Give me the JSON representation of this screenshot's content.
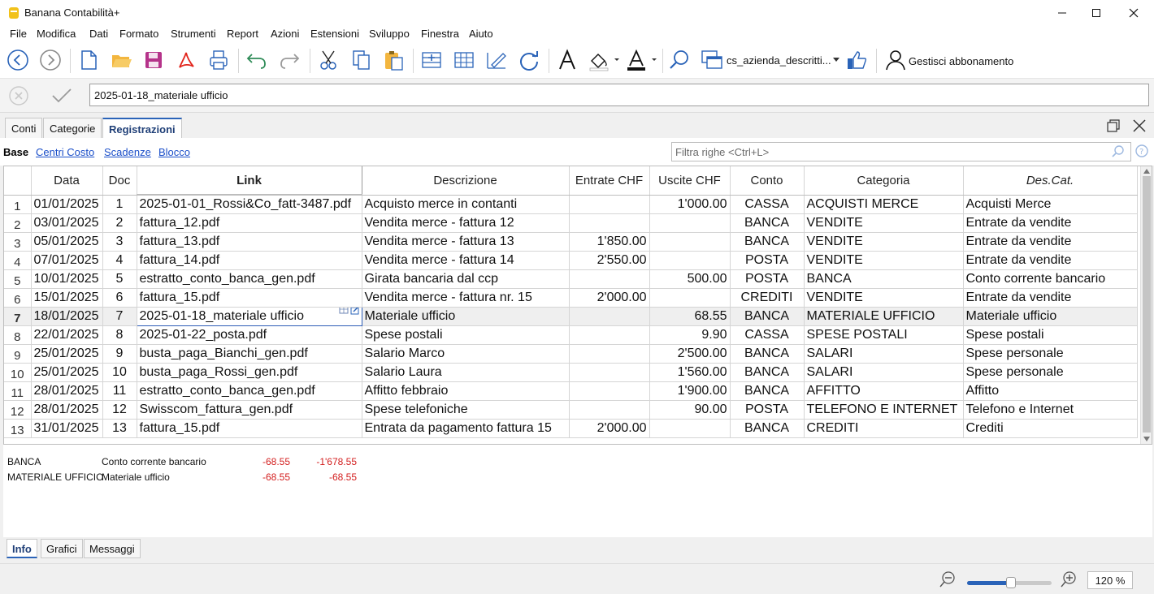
{
  "window": {
    "title": "Banana Contabilità+"
  },
  "menu": [
    "File",
    "Modifica",
    "Dati",
    "Formato",
    "Strumenti",
    "Report",
    "Azioni",
    "Estensioni",
    "Sviluppo",
    "Finestra",
    "Aiuto"
  ],
  "toolbar": {
    "file_name": "cs_azienda_descritti...",
    "subscription_label": "Gestisci abbonamento"
  },
  "edit_bar": {
    "value": "2025-01-18_materiale ufficio"
  },
  "tabs": [
    "Conti",
    "Categorie",
    "Registrazioni"
  ],
  "active_tab": "Registrazioni",
  "views": [
    "Base",
    "Centri Costo",
    "Scadenze",
    "Blocco"
  ],
  "filter": {
    "placeholder": "Filtra righe <Ctrl+L>"
  },
  "table": {
    "headers": [
      "Data",
      "Doc",
      "Link",
      "Descrizione",
      "Entrate CHF",
      "Uscite CHF",
      "Conto",
      "Categoria",
      "Des.Cat."
    ],
    "rows": [
      {
        "n": "1",
        "data": "01/01/2025",
        "doc": "1",
        "link": "2025-01-01_Rossi&Co_fatt-3487.pdf",
        "desc": "Acquisto merce in contanti",
        "entrate": "",
        "uscite": "1'000.00",
        "conto": "CASSA",
        "cat": "ACQUISTI MERCE",
        "descat": "Acquisti Merce"
      },
      {
        "n": "2",
        "data": "03/01/2025",
        "doc": "2",
        "link": "fattura_12.pdf",
        "desc": "Vendita merce - fattura 12",
        "entrate": "",
        "uscite": "",
        "conto": "BANCA",
        "cat": "VENDITE",
        "descat": "Entrate da vendite"
      },
      {
        "n": "3",
        "data": "05/01/2025",
        "doc": "3",
        "link": "fattura_13.pdf",
        "desc": "Vendita merce - fattura 13",
        "entrate": "1'850.00",
        "uscite": "",
        "conto": "BANCA",
        "cat": "VENDITE",
        "descat": "Entrate da vendite"
      },
      {
        "n": "4",
        "data": "07/01/2025",
        "doc": "4",
        "link": "fattura_14.pdf",
        "desc": "Vendita merce - fattura 14",
        "entrate": "2'550.00",
        "uscite": "",
        "conto": "POSTA",
        "cat": "VENDITE",
        "descat": "Entrate da vendite"
      },
      {
        "n": "5",
        "data": "10/01/2025",
        "doc": "5",
        "link": "estratto_conto_banca_gen.pdf",
        "desc": "Girata bancaria dal ccp",
        "entrate": "",
        "uscite": "500.00",
        "conto": "POSTA",
        "cat": "BANCA",
        "descat": "Conto corrente bancario"
      },
      {
        "n": "6",
        "data": "15/01/2025",
        "doc": "6",
        "link": "fattura_15.pdf",
        "desc": "Vendita merce - fattura nr. 15",
        "entrate": "2'000.00",
        "uscite": "",
        "conto": "CREDITI",
        "cat": "VENDITE",
        "descat": "Entrate da vendite"
      },
      {
        "n": "7",
        "data": "18/01/2025",
        "doc": "7",
        "link": "2025-01-18_materiale ufficio",
        "desc": "Materiale ufficio",
        "entrate": "",
        "uscite": "68.55",
        "conto": "BANCA",
        "cat": "MATERIALE UFFICIO",
        "descat": "Materiale ufficio"
      },
      {
        "n": "8",
        "data": "22/01/2025",
        "doc": "8",
        "link": "2025-01-22_posta.pdf",
        "desc": "Spese postali",
        "entrate": "",
        "uscite": "9.90",
        "conto": "CASSA",
        "cat": "SPESE POSTALI",
        "descat": "Spese postali"
      },
      {
        "n": "9",
        "data": "25/01/2025",
        "doc": "9",
        "link": "busta_paga_Bianchi_gen.pdf",
        "desc": "Salario Marco",
        "entrate": "",
        "uscite": "2'500.00",
        "conto": "BANCA",
        "cat": "SALARI",
        "descat": "Spese personale"
      },
      {
        "n": "10",
        "data": "25/01/2025",
        "doc": "10",
        "link": "busta_paga_Rossi_gen.pdf",
        "desc": "Salario Laura",
        "entrate": "",
        "uscite": "1'560.00",
        "conto": "BANCA",
        "cat": "SALARI",
        "descat": "Spese personale"
      },
      {
        "n": "11",
        "data": "28/01/2025",
        "doc": "11",
        "link": "estratto_conto_banca_gen.pdf",
        "desc": "Affitto febbraio",
        "entrate": "",
        "uscite": "1'900.00",
        "conto": "BANCA",
        "cat": "AFFITTO",
        "descat": "Affitto"
      },
      {
        "n": "12",
        "data": "28/01/2025",
        "doc": "12",
        "link": "Swisscom_fattura_gen.pdf",
        "desc": "Spese telefoniche",
        "entrate": "",
        "uscite": "90.00",
        "conto": "POSTA",
        "cat": "TELEFONO E INTERNET",
        "descat": "Telefono e Internet"
      },
      {
        "n": "13",
        "data": "31/01/2025",
        "doc": "13",
        "link": "fattura_15.pdf",
        "desc": "Entrata da pagamento fattura 15",
        "entrate": "2'000.00",
        "uscite": "",
        "conto": "BANCA",
        "cat": "CREDITI",
        "descat": "Crediti"
      }
    ],
    "selected_row": 7
  },
  "info_panel": {
    "rows": [
      {
        "account": "BANCA",
        "description": "Conto corrente bancario",
        "amount": "-68.55",
        "balance": "-1'678.55"
      },
      {
        "account": "MATERIALE UFFICIO",
        "description": "Materiale ufficio",
        "amount": "-68.55",
        "balance": "-68.55"
      }
    ]
  },
  "bottom_tabs": [
    "Info",
    "Grafici",
    "Messaggi"
  ],
  "status": {
    "zoom": "120 %",
    "zoom_level": 0.52
  },
  "colors": {
    "accent": "#2a63b8",
    "negative": "#d31e1e",
    "link": "#1a4ec9"
  }
}
